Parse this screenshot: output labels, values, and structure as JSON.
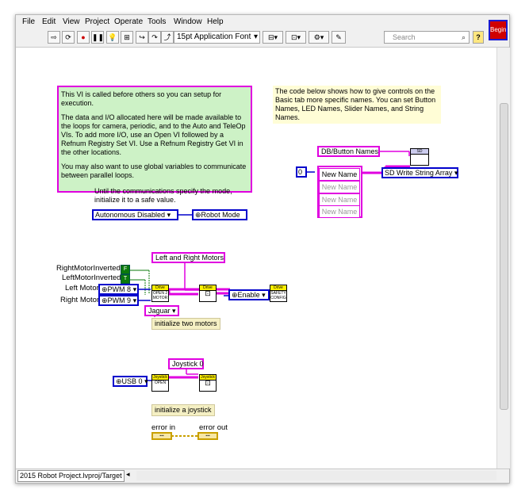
{
  "menubar": [
    "File",
    "Edit",
    "View",
    "Project",
    "Operate",
    "Tools",
    "Window",
    "Help"
  ],
  "toolbar": {
    "font": "15pt Application Font",
    "search_placeholder": "Search",
    "help": "?"
  },
  "begin_icon": "Begin",
  "comments": {
    "setup_p1": "This VI is called before others so you can setup for execution.",
    "setup_p2": "The data and I/O allocated here will be made available to the loops for camera, periodic, and to the Auto and TeleOp VIs. To add more I/O, use an Open VI followed by a Refnum Registry Set VI. Use a Refnum Registry Get VI in the other locations.",
    "setup_p3": "You may also want to use global variables to communicate between parallel loops.",
    "names": "The code below shows how to give controls on the Basic tab more specific names. You can set Button Names, LED Names, Slider Names, and String Names.",
    "mode": "Until the communications specify the mode, initialize it to a safe value.",
    "motors": "initialize two motors",
    "joystick": "initialize a joystick"
  },
  "controls": {
    "mode_value": "Autonomous Disabled",
    "robot_mode": "Robot Mode",
    "db_names": "DB/Button Names",
    "sd_write": "SD Write String Array",
    "index": "0",
    "new_names": [
      "New Name",
      "New Name",
      "New Name",
      "New Name"
    ],
    "motors_name": "Left and Right Motors",
    "right_inv": "RightMotorInverted",
    "left_inv": "LeftMotorInverted",
    "left_motor": "Left Motor",
    "right_motor": "Right Motor",
    "pwm_left": "PWM 8",
    "pwm_right": "PWM 9",
    "bool_true": "T",
    "bool_false": "F",
    "jaguar": "Jaguar",
    "enable": "Enable",
    "joystick_name": "Joystick 0",
    "usb": "USB 0",
    "error_in": "error in",
    "error_out": "error out"
  },
  "vi_icons": {
    "drive": "Drive",
    "open_2motor": "OPEN 2 MOTOR",
    "safety": "SAFETY CONFIG",
    "joystick": "Joystick",
    "open": "OPEN",
    "sd": "SD"
  },
  "status": {
    "path": "2015 Robot Project.lvproj/Target"
  },
  "colors": {
    "comment_green": "#cdf2c6",
    "wire_pink": "#e000e0",
    "wire_blue": "#0000cc",
    "wire_green": "#0b7a0b"
  }
}
